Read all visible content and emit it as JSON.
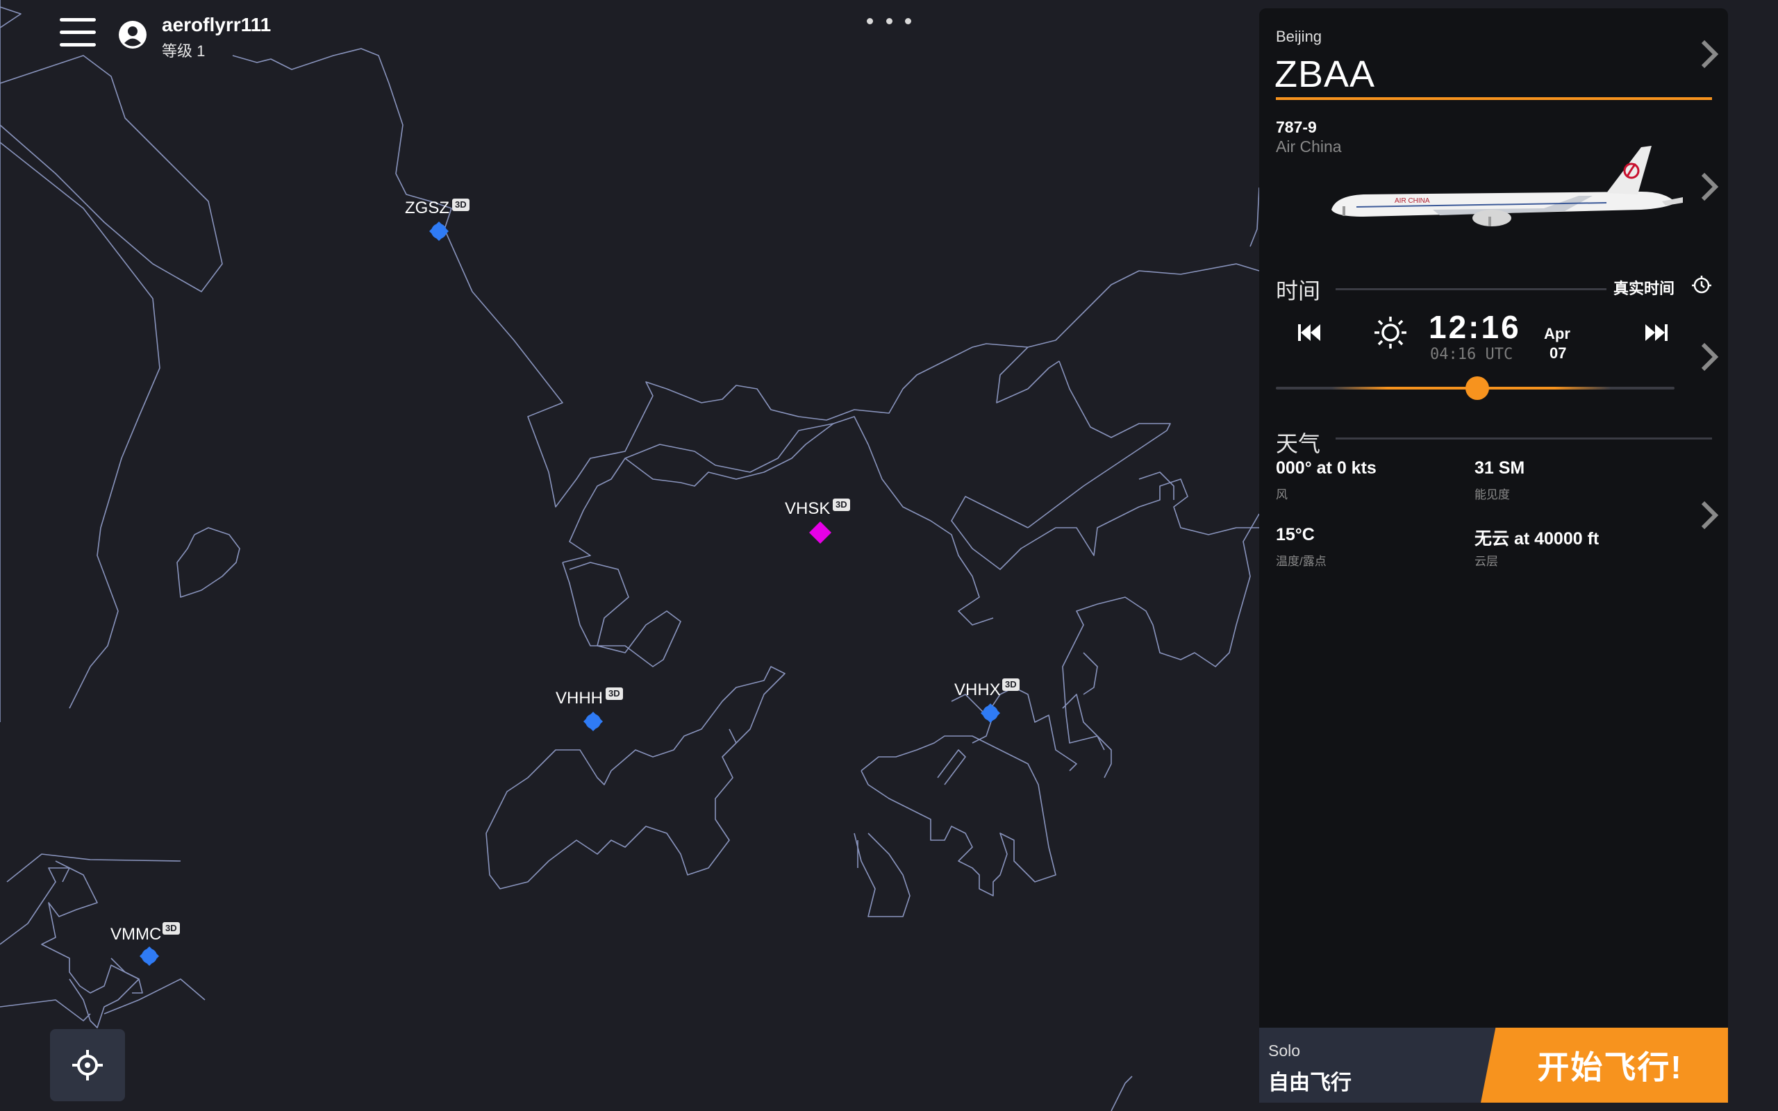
{
  "user": {
    "name": "aeroflyrr111",
    "level": "等级 1"
  },
  "map": {
    "airports": [
      {
        "code": "ZGSZ",
        "badge": "3D",
        "color": "#2f7bf5"
      },
      {
        "code": "VHSK",
        "badge": "3D",
        "color": "#e600e6"
      },
      {
        "code": "VHHH",
        "badge": "3D",
        "color": "#2f7bf5"
      },
      {
        "code": "VHHX",
        "badge": "3D",
        "color": "#2f7bf5"
      },
      {
        "code": "VMMC",
        "badge": "3D",
        "color": "#2f7bf5"
      }
    ]
  },
  "panel": {
    "city": "Beijing",
    "icao": "ZBAA",
    "aircraft_type": "787-9",
    "airline": "Air China",
    "time_section": {
      "title": "时间",
      "realtime_label": "真实时间",
      "local_time": "12:16",
      "utc_time": "04:16 UTC",
      "date_month": "Apr",
      "date_day": "07"
    },
    "weather_section": {
      "title": "天气",
      "wind_value": "000° at 0 kts",
      "wind_label": "风",
      "visibility_value": "31 SM",
      "visibility_label": "能见度",
      "temp_value": "15°C",
      "temp_label": "温度/露点",
      "cloud_value": "无云 at 40000 ft",
      "cloud_label": "云层"
    }
  },
  "bottom": {
    "mode_small": "Solo",
    "mode_big": "自由飞行",
    "start_label": "开始飞行!"
  },
  "colors": {
    "accent": "#f7931e",
    "airport_blue": "#2f7bf5",
    "airport_magenta": "#e600e6",
    "panel_bg": "#111215",
    "map_bg": "#1d1e25"
  },
  "icons": [
    "menu-icon",
    "user-circle-icon",
    "more-dots-icon",
    "chevron-right-icon",
    "skip-back-icon",
    "sun-icon",
    "skip-forward-icon",
    "realtime-clock-icon",
    "crosshair-icon"
  ]
}
